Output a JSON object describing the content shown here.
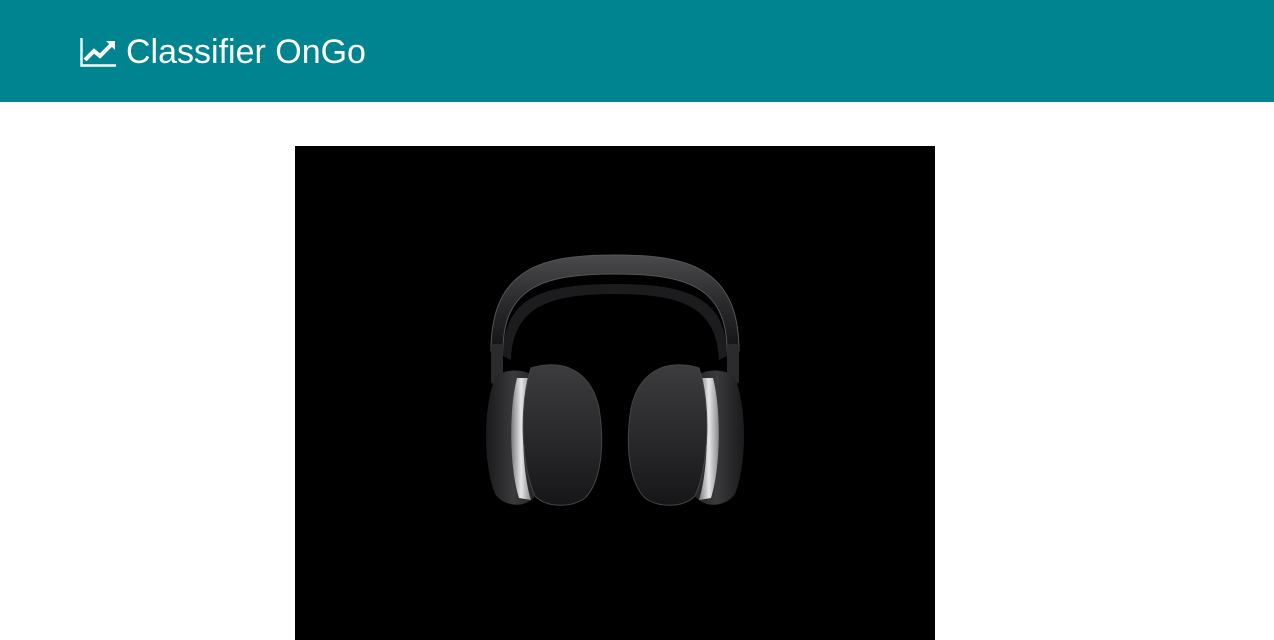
{
  "header": {
    "brand_icon": "line-chart-icon",
    "brand_title": "Classifier OnGo",
    "background_color": "#008490"
  },
  "main": {
    "preview_image": {
      "subject_icon": "headphones-icon",
      "background_color": "#000000"
    }
  }
}
